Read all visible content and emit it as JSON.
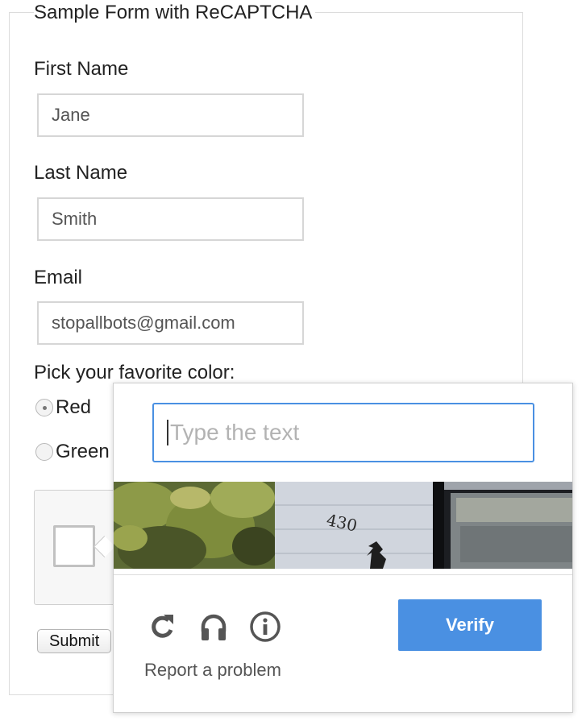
{
  "form": {
    "title": "Sample Form with ReCAPTCHA",
    "first_name": {
      "label": "First Name",
      "value": "Jane"
    },
    "last_name": {
      "label": "Last Name",
      "value": "Smith"
    },
    "email": {
      "label": "Email",
      "value": "stopallbots@gmail.com"
    },
    "color_prompt": "Pick your favorite color:",
    "color_options": [
      {
        "label": "Red",
        "checked": true
      },
      {
        "label": "Green",
        "checked": false
      }
    ],
    "submit_label": "Submit"
  },
  "captcha": {
    "input_placeholder": "Type the text",
    "image_text": "430",
    "icons": [
      "reload-icon",
      "headphones-icon",
      "info-icon"
    ],
    "verify_label": "Verify",
    "report_label": "Report a problem",
    "accent_color": "#4a90e2"
  }
}
